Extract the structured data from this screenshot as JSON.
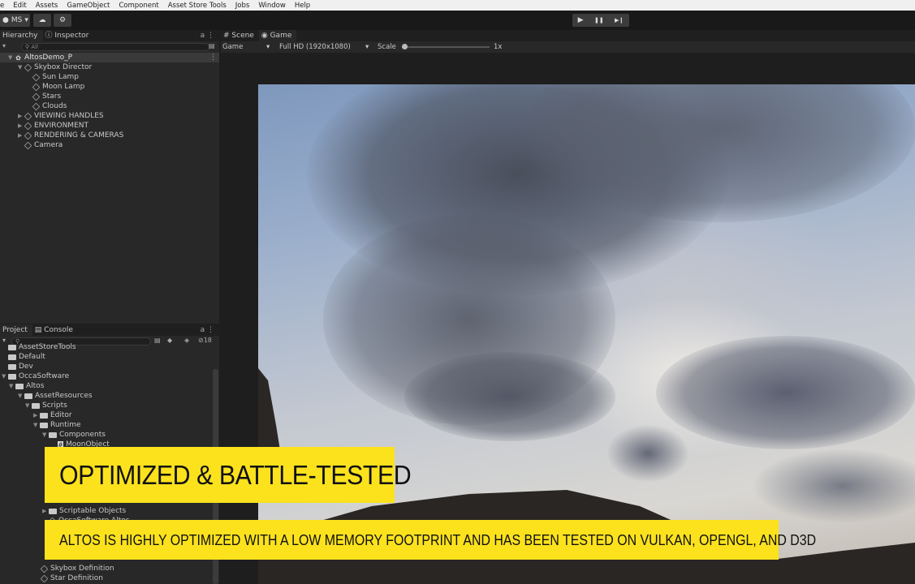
{
  "menu": [
    "e",
    "Edit",
    "Assets",
    "GameObject",
    "Component",
    "Asset Store Tools",
    "Jobs",
    "Window",
    "Help"
  ],
  "toolbar": {
    "account": "MS",
    "cloud_icon": "cloud-icon",
    "collab_icon": "gear-icon"
  },
  "play_controls": {
    "play": "▶",
    "pause": "❚❚",
    "step": "▶❙"
  },
  "hierarchy": {
    "tabs": [
      "Hierarchy",
      "Inspector"
    ],
    "lock": "a ⋮",
    "search_placeholder": "All",
    "root": "AltosDemo_P",
    "root_menu": "⋮",
    "items": [
      "Skybox Director",
      "Sun Lamp",
      "Moon Lamp",
      "Stars",
      "Clouds",
      "VIEWING HANDLES",
      "ENVIRONMENT",
      "RENDERING & CAMERAS",
      "Camera"
    ]
  },
  "game": {
    "tabs": [
      "Scene",
      "Game"
    ],
    "display": "Game",
    "resolution": "Full HD (1920x1080)",
    "scale_label": "Scale",
    "scale_value": "1x",
    "scale_fraction": 0.0
  },
  "project": {
    "tabs": [
      "Project",
      "Console"
    ],
    "lock": "a ⋮",
    "count": "18",
    "items": [
      "AssetStoreTools",
      "Default",
      "Dev",
      "OccaSoftware",
      "Altos",
      "AssetResources",
      "Scripts",
      "Editor",
      "Runtime",
      "Components",
      "MoonObject",
      "Scriptable Objects",
      "OccaSoftware.Altos",
      "Skybox Definition",
      "Star Definition"
    ]
  },
  "overlay": {
    "title": "OPTIMIZED & BATTLE-TESTED",
    "subtitle": "ALTOS IS HIGHLY OPTIMIZED WITH A LOW MEMORY FOOTPRINT AND HAS BEEN TESTED ON VULKAN, OPENGL, AND D3D"
  },
  "colors": {
    "overlay": "#fbe21d",
    "editor_bg": "#282828"
  }
}
